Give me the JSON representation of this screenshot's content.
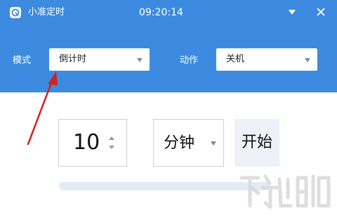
{
  "titlebar": {
    "app_title": "小准定时",
    "clock": "09:20:14",
    "dropdown_icon": "triangle-down-icon",
    "close_icon": "close-icon"
  },
  "settings": {
    "mode_label": "模式",
    "mode_value": "倒计时",
    "action_label": "动作",
    "action_value": "关机"
  },
  "timer": {
    "value": "10",
    "unit": "分钟",
    "start_label": "开始",
    "progress": 0
  },
  "colors": {
    "header": "#3d8be0",
    "annotation_arrow": "#d42020"
  }
}
